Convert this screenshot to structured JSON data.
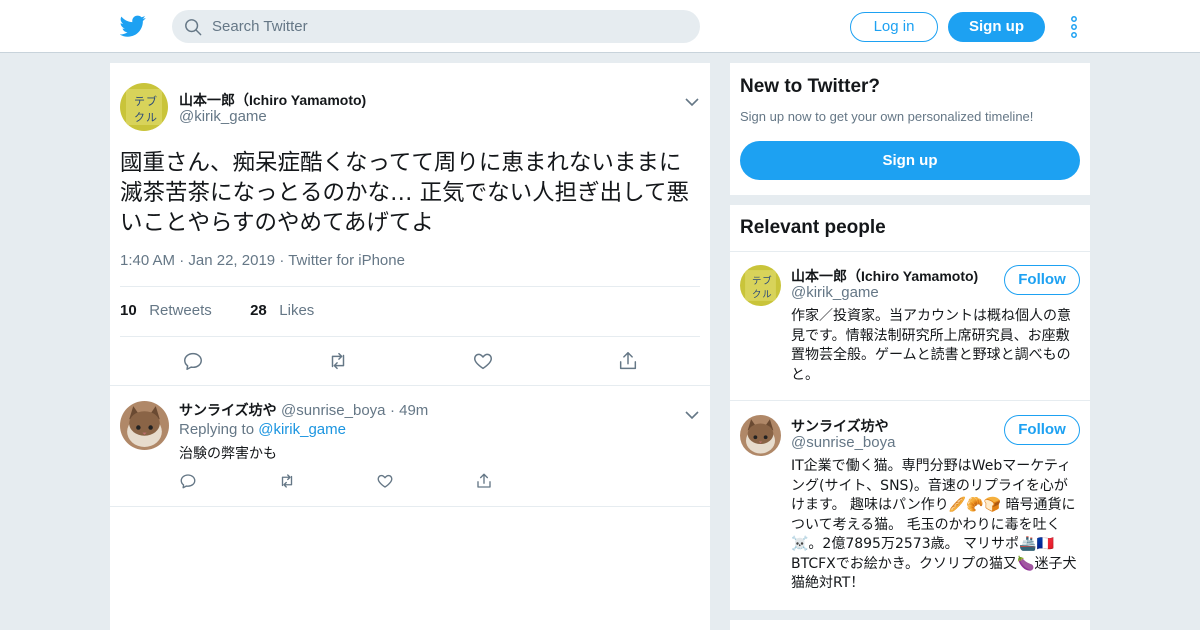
{
  "colors": {
    "brand": "#1da1f2",
    "link": "#1b95e0",
    "muted": "#657786",
    "text": "#14171a",
    "background": "#e6ecf0"
  },
  "header": {
    "logo_icon": "twitter-bird-icon",
    "search_placeholder": "Search Twitter",
    "login_label": "Log in",
    "signup_label": "Sign up",
    "more_icon": "kebab-menu-icon"
  },
  "tweet": {
    "author_name": "山本一郎（Ichiro Yamamoto)",
    "author_handle": "@kirik_game",
    "text": "國重さん、痴呆症酷くなってて周りに恵まれないままに滅茶苦茶になっとるのかな… 正気でない人担ぎ出して悪いことやらすのやめてあげてよ",
    "time": "1:40 AM",
    "date": "Jan 22, 2019",
    "source": "Twitter for iPhone",
    "retweets_count": "10",
    "retweets_label": "Retweets",
    "likes_count": "28",
    "likes_label": "Likes"
  },
  "reply": {
    "author_name": "サンライズ坊や",
    "author_handle": "@sunrise_boya",
    "age": "49m",
    "replying_prefix": "Replying to",
    "replying_to": "@kirik_game",
    "text": "治験の弊害かも"
  },
  "signup_panel": {
    "title": "New to Twitter?",
    "subtitle": "Sign up now to get your own personalized timeline!",
    "button_label": "Sign up"
  },
  "relevant_people": {
    "title": "Relevant people",
    "people": [
      {
        "name": "山本一郎（Ichiro Yamamoto)",
        "handle": "@kirik_game",
        "follow_label": "Follow",
        "bio": "作家／投資家。当アカウントは概ね個人の意見です。情報法制研究所上席研究員、お座敷置物芸全般。ゲームと読書と野球と調べものと。"
      },
      {
        "name": "サンライズ坊や",
        "handle": "@sunrise_boya",
        "follow_label": "Follow",
        "bio": "IT企業で働く猫。専門分野はWebマーケティング(サイト、SNS)。音速のリプライを心がけます。 趣味はパン作り🥖🥐🍞 暗号通貨について考える猫。 毛玉のかわりに毒を吐く☠️。2億7895万2573歳。 マリサポ🚢🇫🇷 BTCFXでお絵かき。クソリプの猫又🍆迷子犬猫絶対RT！"
      }
    ]
  }
}
